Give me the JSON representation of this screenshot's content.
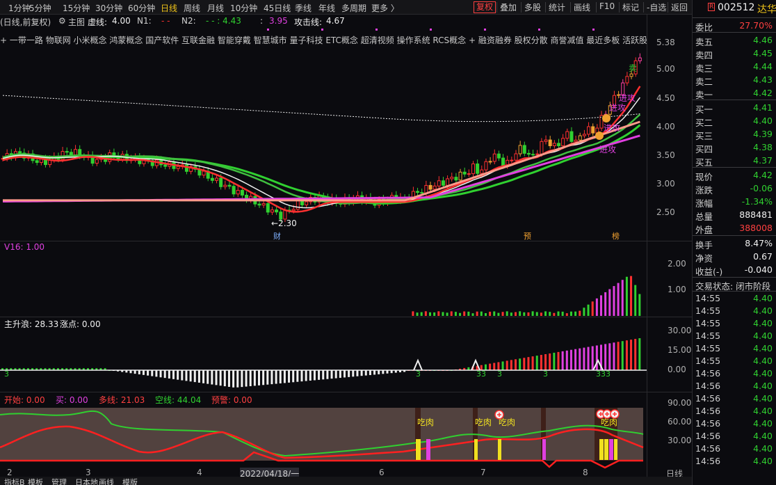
{
  "topbar": {
    "periods": [
      "1分钟",
      "5分钟",
      "15分钟",
      "30分钟",
      "60分钟",
      "日线",
      "周线",
      "月线",
      "10分钟",
      "45日线",
      "季线",
      "年线",
      "多周期",
      "更多 〉"
    ],
    "active_period": "日线",
    "buttons": [
      "复权",
      "叠加",
      "多股",
      "统计",
      "画线",
      "F10",
      "标记",
      "-自选",
      "返回"
    ],
    "highlight_button": "复权"
  },
  "main_panel": {
    "title": "(日线,前复权)",
    "mode_label": "主图",
    "indicators": [
      {
        "label": "虚线:",
        "value": "4.00",
        "color": "#f0f0f0"
      },
      {
        "label": "N1:",
        "value": "- -",
        "color": "#ff3030"
      },
      {
        "label": "N2:",
        "value": "- - : 4.43",
        "color": "#30d030"
      },
      {
        "label": ":",
        "value": "3.95",
        "color": "#e040e0"
      },
      {
        "label": "攻击线:",
        "value": "4.67",
        "color": "#f0f0f0"
      }
    ],
    "concepts": [
      "一带一路",
      "物联网",
      "小米概念",
      "鸿蒙概念",
      "国产软件",
      "互联金融",
      "智能穿戴",
      "智慧城市",
      "量子科技",
      "ETC概念",
      "超清视频",
      "操作系统",
      "RCS概念",
      "+ 融资融券",
      "股权分散",
      "商誉减值",
      "最近多板",
      "活跃股"
    ],
    "price_axis": [
      "5.38",
      "5.00",
      "4.50",
      "4.00",
      "3.50",
      "3.00",
      "2.50"
    ],
    "low_marker": "←2.30",
    "tags": [
      "财",
      "预",
      "榜"
    ],
    "labels": {
      "sell": "卖",
      "attack1": "进攻",
      "attack2": "进攻",
      "attack3": "进攻",
      "attack4": "进攻"
    }
  },
  "v16_panel": {
    "label": "V16: 1.00",
    "axis": [
      "2.00",
      "1.00"
    ]
  },
  "wave_panel": {
    "label1": "主升浪: 28.33",
    "label2": "涨点: 0.00",
    "axis": [
      "30.00",
      "15.00",
      "0.00"
    ],
    "marks": [
      "3",
      "3",
      "33",
      "3",
      "3",
      "333"
    ]
  },
  "bottom_panel": {
    "indicators": [
      {
        "label": "开始:",
        "value": "0.00",
        "color": "#ff4040"
      },
      {
        "label": "买:",
        "value": "0.00",
        "color": "#e040e0"
      },
      {
        "label": "多线:",
        "value": "21.03",
        "color": "#ff4040"
      },
      {
        "label": "空线:",
        "value": "44.04",
        "color": "#30d030"
      },
      {
        "label": "预警:",
        "value": "0.00",
        "color": "#ff4040"
      }
    ],
    "axis": [
      "90.00",
      "60.00",
      "30.00"
    ],
    "eat_labels": [
      "吃肉",
      "吃肉",
      "吃肉",
      "吃肉"
    ]
  },
  "date_axis": {
    "labels": [
      "2",
      "3",
      "4",
      "2022/04/18/一",
      "6",
      "7",
      "8"
    ],
    "period": "日线"
  },
  "right_panel": {
    "code": "002512",
    "name": "达华",
    "badge": "R",
    "weibi": {
      "label": "委比",
      "value": "27.70%"
    },
    "asks": [
      {
        "label": "卖五",
        "price": "4.46"
      },
      {
        "label": "卖四",
        "price": "4.45"
      },
      {
        "label": "卖三",
        "price": "4.44"
      },
      {
        "label": "卖二",
        "price": "4.43"
      },
      {
        "label": "卖一",
        "price": "4.42"
      }
    ],
    "bids": [
      {
        "label": "买一",
        "price": "4.41"
      },
      {
        "label": "买二",
        "price": "4.40"
      },
      {
        "label": "买三",
        "price": "4.39"
      },
      {
        "label": "买四",
        "price": "4.38"
      },
      {
        "label": "买五",
        "price": "4.37"
      }
    ],
    "stats": [
      {
        "label": "现价",
        "value": "4.42",
        "color": "#30d030"
      },
      {
        "label": "涨跌",
        "value": "-0.06",
        "color": "#30d030"
      },
      {
        "label": "涨幅",
        "value": "-1.34%",
        "color": "#30d030"
      },
      {
        "label": "总量",
        "value": "888481",
        "color": "#f0f0f0"
      },
      {
        "label": "外盘",
        "value": "388008",
        "color": "#ff4040"
      }
    ],
    "stats2": [
      {
        "label": "换手",
        "value": "8.47%",
        "color": "#f0f0f0"
      },
      {
        "label": "净资",
        "value": "0.67",
        "color": "#f0f0f0"
      },
      {
        "label": "收益(-)",
        "value": "-0.040",
        "color": "#f0f0f0"
      }
    ],
    "trade_status": "交易状态: 闭市阶段",
    "ticks": [
      {
        "t": "14:55",
        "p": "4.40"
      },
      {
        "t": "14:55",
        "p": "4.40"
      },
      {
        "t": "14:55",
        "p": "4.40"
      },
      {
        "t": "14:55",
        "p": "4.40"
      },
      {
        "t": "14:55",
        "p": "4.40"
      },
      {
        "t": "14:55",
        "p": "4.40"
      },
      {
        "t": "14:56",
        "p": "4.40"
      },
      {
        "t": "14:56",
        "p": "4.40"
      },
      {
        "t": "14:56",
        "p": "4.40"
      },
      {
        "t": "14:56",
        "p": "4.40"
      },
      {
        "t": "14:56",
        "p": "4.40"
      },
      {
        "t": "14:56",
        "p": "4.40"
      },
      {
        "t": "14:56",
        "p": "4.40"
      },
      {
        "t": "14:56",
        "p": "4.40"
      }
    ]
  },
  "bottombar": {
    "tabs": [
      "指标B",
      "模板",
      "管理",
      "日本地",
      "画线",
      "模版"
    ]
  },
  "colors": {
    "up": "#ff3030",
    "down": "#30d030",
    "magenta": "#e040e0",
    "orange": "#f0a030",
    "yellow": "#f0e020"
  }
}
